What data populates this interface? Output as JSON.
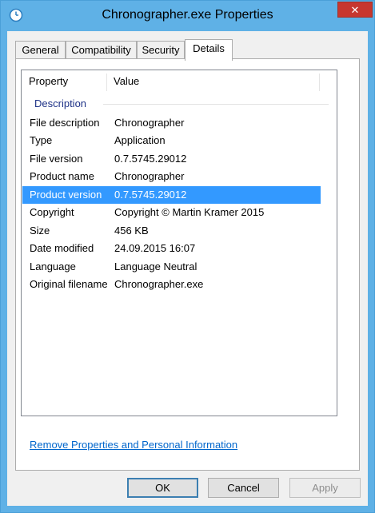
{
  "window": {
    "title": "Chronographer.exe Properties",
    "close_glyph": "✕",
    "app_icon": "clock-icon"
  },
  "tabs": [
    {
      "label": "General"
    },
    {
      "label": "Compatibility"
    },
    {
      "label": "Security"
    },
    {
      "label": "Details"
    }
  ],
  "list": {
    "columns": [
      "Property",
      "Value"
    ],
    "group": "Description",
    "rows": [
      {
        "property": "File description",
        "value": "Chronographer"
      },
      {
        "property": "Type",
        "value": "Application"
      },
      {
        "property": "File version",
        "value": "0.7.5745.29012"
      },
      {
        "property": "Product name",
        "value": "Chronographer"
      },
      {
        "property": "Product version",
        "value": "0.7.5745.29012"
      },
      {
        "property": "Copyright",
        "value": "Copyright © Martin Kramer 2015"
      },
      {
        "property": "Size",
        "value": "456 KB"
      },
      {
        "property": "Date modified",
        "value": "24.09.2015 16:07"
      },
      {
        "property": "Language",
        "value": "Language Neutral"
      },
      {
        "property": "Original filename",
        "value": "Chronographer.exe"
      }
    ],
    "selected_index": 4
  },
  "link": "Remove Properties and Personal Information",
  "buttons": {
    "ok": "OK",
    "cancel": "Cancel",
    "apply": "Apply"
  },
  "colors": {
    "titlebar": "#5fb1e6",
    "selection": "#3399ff",
    "close": "#c7372f",
    "link": "#0066cc"
  }
}
